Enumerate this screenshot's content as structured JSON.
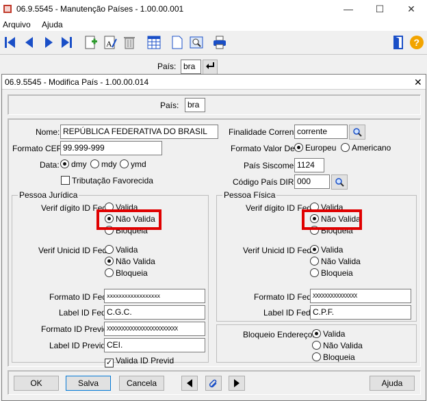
{
  "window": {
    "title": "06.9.5545 - Manutenção Países - 1.00.00.001",
    "minimize": "—",
    "maximize": "☐",
    "close": "✕"
  },
  "menu": {
    "items": [
      "Arquivo",
      "Ajuda"
    ]
  },
  "background": {
    "pais_label": "País:",
    "pais_value": "bra"
  },
  "dialog": {
    "title": "06.9.5545 - Modifica País - 1.00.00.014",
    "close": "✕",
    "pais_label": "País:",
    "pais_value": "bra",
    "nome_label": "Nome:",
    "nome_value": "REPÚBLICA FEDERATIVA DO BRASIL",
    "cep_label": "Formato CEP:",
    "cep_value": "99.999-999",
    "data_label": "Data:",
    "data_options": [
      "dmy",
      "mdy",
      "ymd"
    ],
    "data_selected": "dmy",
    "tributacao_label": "Tributação Favorecida",
    "tributacao_checked": false,
    "finalidade_label": "Finalidade Corrente:",
    "finalidade_value": "corrente",
    "formato_dec_label": "Formato Valor Dec:",
    "formato_dec_options": [
      "Europeu",
      "Americano"
    ],
    "formato_dec_selected": "Europeu",
    "siscomex_label": "País Siscomex:",
    "siscomex_value": "1124",
    "dirf_label": "Código País DIRF:",
    "dirf_value": "000",
    "pj": {
      "title": "Pessoa Jurídica",
      "verif_label": "Verif dígito ID Fed:",
      "verif_options": [
        "Valida",
        "Não Valida",
        "Bloqueia"
      ],
      "verif_selected": "Não Valida",
      "unicid_label": "Verif Unicid ID Fed:",
      "unicid_options": [
        "Valida",
        "Não Valida",
        "Bloqueia"
      ],
      "unicid_selected": "Não Valida",
      "formato_fed_label": "Formato ID Fed:",
      "formato_fed_value": "xxxxxxxxxxxxxxxxxx",
      "label_fed_label": "Label ID Fed:",
      "label_fed_value": "C.G.C.",
      "formato_previd_label": "Formato ID Previd:",
      "formato_previd_value": "XXXXXXXXXXXXXXXXXXXXXXXX",
      "label_previd_label": "Label ID Previd:",
      "label_previd_value": "CEI.",
      "valida_previd_label": "Valida ID Previd",
      "valida_previd_checked": true
    },
    "pf": {
      "title": "Pessoa Física",
      "verif_label": "Verif dígito ID Fed:",
      "verif_options": [
        "Valida",
        "Não Valida",
        "Bloqueia"
      ],
      "verif_selected": "Não Valida",
      "unicid_label": "Verif Unicid ID Fed:",
      "unicid_options": [
        "Valida",
        "Não Valida",
        "Bloqueia"
      ],
      "unicid_selected": "Valida",
      "formato_fed_label": "Formato ID Fed:",
      "formato_fed_value": "XXXXXXXXXXXXXXX",
      "label_fed_label": "Label ID Fed:",
      "label_fed_value": "C.P.F."
    },
    "bloqueio_label": "Bloqueio Endereço:",
    "bloqueio_options": [
      "Valida",
      "Não Valida",
      "Bloqueia"
    ],
    "bloqueio_selected": "Valida",
    "buttons": {
      "ok": "OK",
      "salva": "Salva",
      "cancela": "Cancela",
      "ajuda": "Ajuda"
    }
  },
  "colors": {
    "highlight": "#e00000",
    "accent": "#1a4fc7"
  },
  "icons": [
    "first-record-icon",
    "prev-record-icon",
    "next-record-icon",
    "last-record-icon",
    "add-icon",
    "edit-icon",
    "delete-icon",
    "grid-icon",
    "document-icon",
    "zoom-icon",
    "print-icon",
    "exit-icon",
    "help-icon"
  ]
}
